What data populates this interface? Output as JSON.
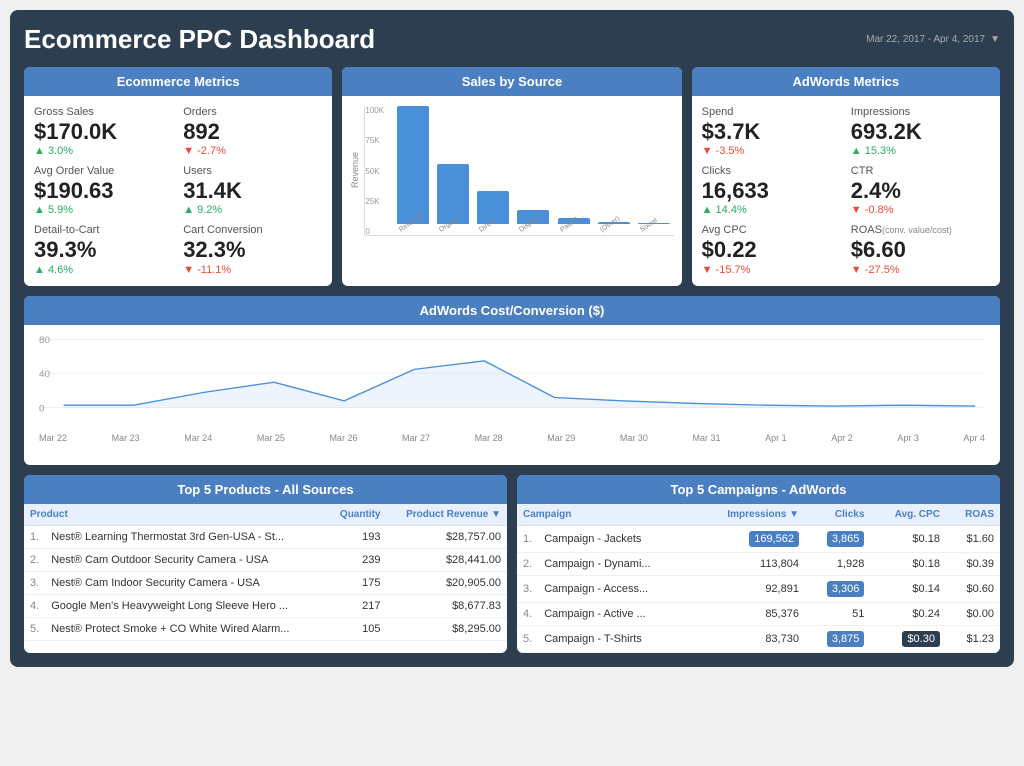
{
  "header": {
    "title": "Ecommerce PPC Dashboard",
    "date_range": "Mar 22, 2017 - Apr 4, 2017"
  },
  "ecommerce_metrics": {
    "title": "Ecommerce Metrics",
    "items": [
      {
        "label": "Gross Sales",
        "value": "$170.0K",
        "change": "▲ 3.0%",
        "up": true
      },
      {
        "label": "Orders",
        "value": "892",
        "change": "▼ -2.7%",
        "up": false
      },
      {
        "label": "Avg Order Value",
        "value": "$190.63",
        "change": "▲ 5.9%",
        "up": true
      },
      {
        "label": "Users",
        "value": "31.4K",
        "change": "▲ 9.2%",
        "up": true
      },
      {
        "label": "Detail-to-Cart",
        "value": "39.3%",
        "change": "▲ 4.6%",
        "up": true
      },
      {
        "label": "Cart Conversion",
        "value": "32.3%",
        "change": "▼ -11.1%",
        "up": false
      }
    ]
  },
  "sales_by_source": {
    "title": "Sales by Source",
    "y_labels": [
      "100K",
      "75K",
      "50K",
      "25K",
      "0"
    ],
    "bars": [
      {
        "label": "Referral",
        "height_pct": 95
      },
      {
        "label": "Organic Se...",
        "height_pct": 48
      },
      {
        "label": "Direct",
        "height_pct": 27
      },
      {
        "label": "Display",
        "height_pct": 11
      },
      {
        "label": "Paid Searc...",
        "height_pct": 5
      },
      {
        "label": "(Other)",
        "height_pct": 2
      },
      {
        "label": "Social",
        "height_pct": 1
      }
    ],
    "y_axis_label": "Revenue"
  },
  "adwords_metrics": {
    "title": "AdWords Metrics",
    "items": [
      {
        "label": "Spend",
        "value": "$3.7K",
        "change": "▼ -3.5%",
        "up": false
      },
      {
        "label": "Impressions",
        "value": "693.2K",
        "change": "▲ 15.3%",
        "up": true
      },
      {
        "label": "Clicks",
        "value": "16,633",
        "change": "▲ 14.4%",
        "up": true
      },
      {
        "label": "CTR",
        "value": "2.4%",
        "change": "▼ -0.8%",
        "up": false
      },
      {
        "label": "Avg CPC",
        "value": "$0.22",
        "change": "▼ -15.7%",
        "up": false
      },
      {
        "label": "ROAS",
        "sublabel": "(conv. value/cost)",
        "value": "$6.60",
        "change": "▼ -27.5%",
        "up": false
      }
    ]
  },
  "cost_conversion": {
    "title": "AdWords Cost/Conversion ($)",
    "x_labels": [
      "Mar 22",
      "Mar 23",
      "Mar 24",
      "Mar 25",
      "Mar 26",
      "Mar 27",
      "Mar 28",
      "Mar 29",
      "Mar 30",
      "Mar 31",
      "Apr 1",
      "Apr 2",
      "Apr 3",
      "Apr 4"
    ],
    "y_labels": [
      "0",
      "40",
      "80"
    ],
    "points": [
      3,
      3,
      18,
      30,
      8,
      45,
      55,
      12,
      8,
      5,
      3,
      2,
      3,
      2
    ]
  },
  "top_products": {
    "title": "Top 5 Products - All Sources",
    "columns": [
      "Product",
      "Quantity",
      "Product Revenue ▼"
    ],
    "rows": [
      {
        "num": "1.",
        "name": "Nest® Learning Thermostat 3rd Gen-USA - St...",
        "quantity": "193",
        "revenue": "$28,757.00"
      },
      {
        "num": "2.",
        "name": "Nest® Cam Outdoor Security Camera - USA",
        "quantity": "239",
        "revenue": "$28,441.00"
      },
      {
        "num": "3.",
        "name": "Nest® Cam Indoor Security Camera - USA",
        "quantity": "175",
        "revenue": "$20,905.00"
      },
      {
        "num": "4.",
        "name": "Google Men's Heavyweight Long Sleeve Hero ...",
        "quantity": "217",
        "revenue": "$8,677.83"
      },
      {
        "num": "5.",
        "name": "Nest® Protect Smoke + CO White Wired Alarm...",
        "quantity": "105",
        "revenue": "$8,295.00"
      }
    ]
  },
  "top_campaigns": {
    "title": "Top 5 Campaigns - AdWords",
    "columns": [
      "Campaign",
      "Impressions ▼",
      "Clicks",
      "Avg. CPC",
      "ROAS"
    ],
    "rows": [
      {
        "num": "1.",
        "name": "Campaign - Jackets",
        "impressions": "169,562",
        "impressions_hi": true,
        "clicks": "3,865",
        "clicks_hi": true,
        "cpc": "$0.18",
        "roas": "$1.60",
        "roas_hi": false
      },
      {
        "num": "2.",
        "name": "Campaign - Dynami...",
        "impressions": "113,804",
        "impressions_hi": false,
        "clicks": "1,928",
        "clicks_hi": false,
        "cpc": "$0.18",
        "roas": "$0.39",
        "roas_hi": false
      },
      {
        "num": "3.",
        "name": "Campaign - Access...",
        "impressions": "92,891",
        "impressions_hi": false,
        "clicks": "3,306",
        "clicks_hi": true,
        "cpc": "$0.14",
        "roas": "$0.60",
        "roas_hi": false
      },
      {
        "num": "4.",
        "name": "Campaign - Active ...",
        "impressions": "85,376",
        "impressions_hi": false,
        "clicks": "51",
        "clicks_hi": false,
        "cpc": "$0.24",
        "roas": "$0.00",
        "roas_hi": false
      },
      {
        "num": "5.",
        "name": "Campaign - T-Shirts",
        "impressions": "83,730",
        "impressions_hi": false,
        "clicks": "3,875",
        "clicks_hi": true,
        "cpc": "$0.30",
        "cpc_dark": true,
        "roas": "$1.23",
        "roas_hi": false
      }
    ]
  }
}
